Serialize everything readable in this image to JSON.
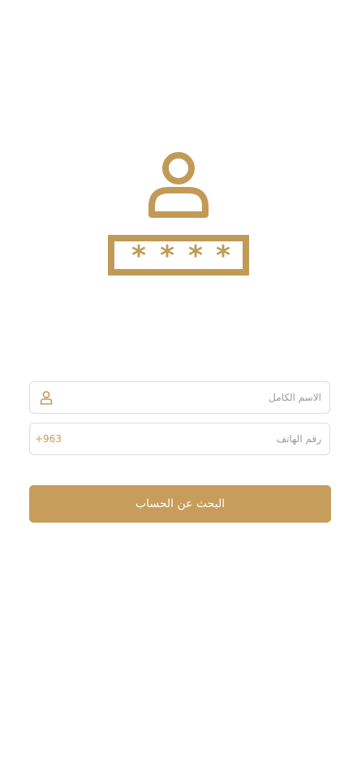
{
  "illustration": {
    "icon": "account-password-icon",
    "mask": "* * * *",
    "color": "#c29a57"
  },
  "form": {
    "full_name": {
      "placeholder": "الاسم الكامل",
      "value": "",
      "icon": "user-icon"
    },
    "phone": {
      "placeholder": "رقم الهاتف",
      "value": "",
      "country_code": "+963"
    },
    "submit_label": "البحث عن الحساب"
  },
  "colors": {
    "accent": "#c69d5a",
    "field_border": "#dcdcdc",
    "background": "#ffffff"
  }
}
